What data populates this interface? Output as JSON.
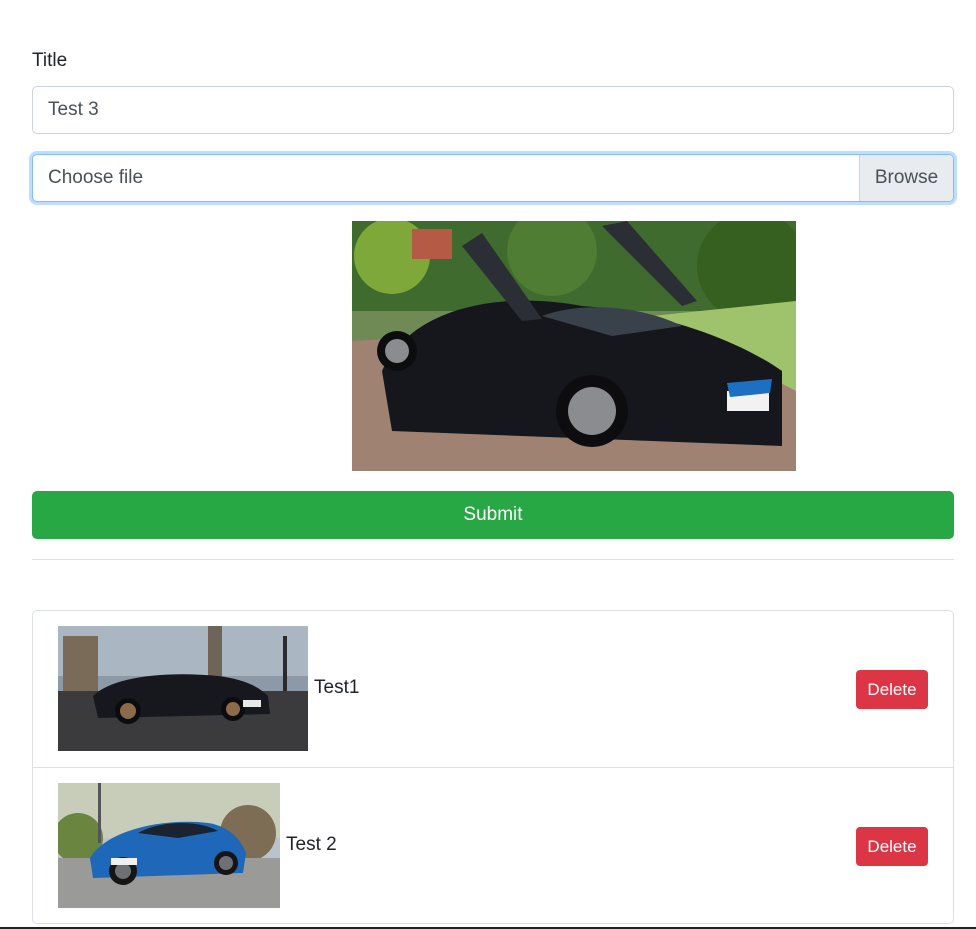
{
  "form": {
    "title_label": "Title",
    "title_value": "Test 3",
    "file_label": "Choose file",
    "browse_label": "Browse",
    "submit_label": "Submit"
  },
  "preview": {
    "icon": "car-photo-icon"
  },
  "items": [
    {
      "name": "Test1",
      "delete_label": "Delete",
      "icon": "car-photo-icon"
    },
    {
      "name": "Test 2",
      "delete_label": "Delete",
      "icon": "car-photo-icon"
    }
  ],
  "colors": {
    "submit": "#28a745",
    "delete": "#dc3545",
    "focus_border": "#80bdff"
  }
}
